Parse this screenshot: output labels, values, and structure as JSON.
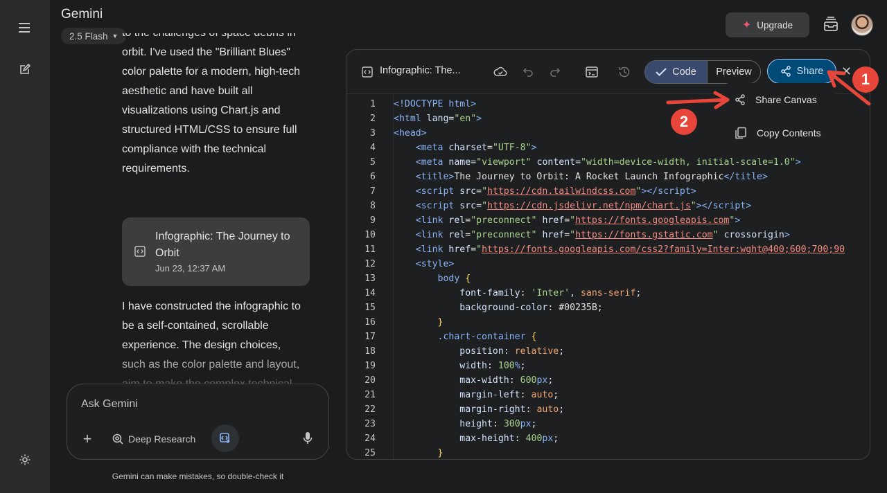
{
  "app": {
    "title": "Gemini",
    "model": "2.5 Flash"
  },
  "header": {
    "upgrade_label": "Upgrade"
  },
  "chat": {
    "paragraph_1_lines": [
      "to the challenges of space debris in",
      "orbit. I've used the \"Brilliant Blues\"",
      "color palette for a modern, high-tech",
      "aesthetic and have built all",
      "visualizations using Chart.js and",
      "structured HTML/CSS to ensure full",
      "compliance with the technical",
      "requirements."
    ],
    "card": {
      "title": "Infographic: The Journey to Orbit",
      "date": "Jun 23, 12:37 AM"
    },
    "paragraph_2_lines": [
      "I have constructed the infographic to",
      "be a self-contained, scrollable",
      "experience. The design choices,",
      "such as the color palette and layout,",
      "aim to make the complex technical"
    ]
  },
  "input": {
    "placeholder": "Ask Gemini",
    "deep_research_label": "Deep Research",
    "disclaimer": "Gemini can make mistakes, so double-check it"
  },
  "panel": {
    "title": "Infographic: The...",
    "code_tab": "Code",
    "preview_tab": "Preview",
    "share_label": "Share",
    "share_menu": [
      "Share Canvas",
      "Copy Contents"
    ]
  },
  "code_lines": [
    {
      "n": "1",
      "html": "<span class='t-tag'>&lt;!DOCTYPE html&gt;</span>"
    },
    {
      "n": "2",
      "html": "<span class='t-tag'>&lt;html</span> <span class='t-attr'>lang</span>=<span class='t-str'>\"en\"</span><span class='t-tag'>&gt;</span>"
    },
    {
      "n": "3",
      "html": "<span class='t-tag'>&lt;head&gt;</span>"
    },
    {
      "n": "4",
      "html": "    <span class='t-tag'>&lt;meta</span> <span class='t-attr'>charset</span>=<span class='t-str'>\"UTF-8\"</span><span class='t-tag'>&gt;</span>"
    },
    {
      "n": "5",
      "html": "    <span class='t-tag'>&lt;meta</span> <span class='t-attr'>name</span>=<span class='t-str'>\"viewport\"</span> <span class='t-attr'>content</span>=<span class='t-str'>\"width=device-width, initial-scale=1.0\"</span><span class='t-tag'>&gt;</span>"
    },
    {
      "n": "6",
      "html": "    <span class='t-tag'>&lt;title&gt;</span>The Journey to Orbit: A Rocket Launch Infographic<span class='t-tag'>&lt;/title&gt;</span>"
    },
    {
      "n": "7",
      "html": "    <span class='t-tag'>&lt;script</span> <span class='t-attr'>src</span>=<span class='t-str'>\"</span><span class='t-url'>https://cdn.tailwindcss.com</span><span class='t-str'>\"</span><span class='t-tag'>&gt;&lt;/script&gt;</span>"
    },
    {
      "n": "8",
      "html": "    <span class='t-tag'>&lt;script</span> <span class='t-attr'>src</span>=<span class='t-str'>\"</span><span class='t-url'>https://cdn.jsdelivr.net/npm/chart.js</span><span class='t-str'>\"</span><span class='t-tag'>&gt;&lt;/script&gt;</span>"
    },
    {
      "n": "9",
      "html": "    <span class='t-tag'>&lt;link</span> <span class='t-attr'>rel</span>=<span class='t-str'>\"preconnect\"</span> <span class='t-attr'>href</span>=<span class='t-str'>\"</span><span class='t-url'>https://fonts.googleapis.com</span><span class='t-str'>\"</span><span class='t-tag'>&gt;</span>"
    },
    {
      "n": "10",
      "html": "    <span class='t-tag'>&lt;link</span> <span class='t-attr'>rel</span>=<span class='t-str'>\"preconnect\"</span> <span class='t-attr'>href</span>=<span class='t-str'>\"</span><span class='t-url'>https://fonts.gstatic.com</span><span class='t-str'>\"</span> <span class='t-attr'>crossorigin</span><span class='t-tag'>&gt;</span>"
    },
    {
      "n": "11",
      "html": "    <span class='t-tag'>&lt;link</span> <span class='t-attr'>href</span>=<span class='t-str'>\"</span><span class='t-url'>https://fonts.googleapis.com/css2?family=Inter:wght@400;600;700;90</span>"
    },
    {
      "n": "12",
      "html": "    <span class='t-tag'>&lt;style&gt;</span>"
    },
    {
      "n": "13",
      "html": "        <span class='t-sel'>body</span> <span class='t-brace'>{</span>"
    },
    {
      "n": "14",
      "html": "            <span class='t-prop'>font-family</span>: <span class='t-str'>'Inter'</span>, <span class='t-val'>sans-serif</span>;"
    },
    {
      "n": "15",
      "html": "            <span class='t-prop'>background-color</span>: #00235B;"
    },
    {
      "n": "16",
      "html": "        <span class='t-brace'>}</span>"
    },
    {
      "n": "17",
      "html": "        <span class='t-sel'>.chart-container</span> <span class='t-brace'>{</span>"
    },
    {
      "n": "18",
      "html": "            <span class='t-prop'>position</span>: <span class='t-val'>relative</span>;"
    },
    {
      "n": "19",
      "html": "            <span class='t-prop'>width</span>: <span class='t-num'>100</span><span class='t-pt'>%</span>;"
    },
    {
      "n": "20",
      "html": "            <span class='t-prop'>max-width</span>: <span class='t-num'>600</span><span class='t-pt'>px</span>;"
    },
    {
      "n": "21",
      "html": "            <span class='t-prop'>margin-left</span>: <span class='t-val'>auto</span>;"
    },
    {
      "n": "22",
      "html": "            <span class='t-prop'>margin-right</span>: <span class='t-val'>auto</span>;"
    },
    {
      "n": "23",
      "html": "            <span class='t-prop'>height</span>: <span class='t-num'>300</span><span class='t-pt'>px</span>;"
    },
    {
      "n": "24",
      "html": "            <span class='t-prop'>max-height</span>: <span class='t-num'>400</span><span class='t-pt'>px</span>;"
    },
    {
      "n": "25",
      "html": "        <span class='t-brace'>}</span>"
    }
  ],
  "annotations": {
    "step_1": "1",
    "step_2": "2",
    "arrow_color": "#e8463a"
  }
}
